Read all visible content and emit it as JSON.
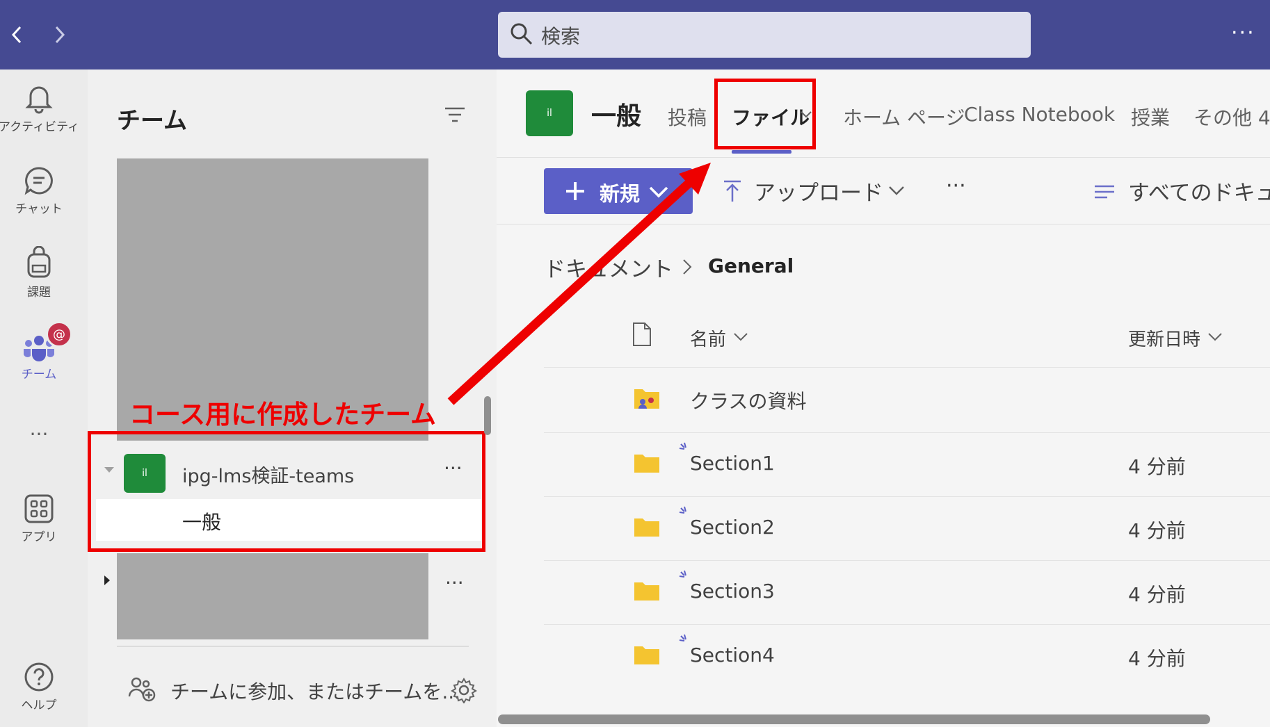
{
  "search": {
    "placeholder": "検索"
  },
  "rail": {
    "items": [
      {
        "label": "アクティビティ",
        "icon": "bell-icon"
      },
      {
        "label": "チャット",
        "icon": "chat-icon"
      },
      {
        "label": "課題",
        "icon": "backpack-icon"
      },
      {
        "label": "チーム",
        "icon": "teams-icon",
        "badge": "@"
      },
      {
        "label": "アプリ",
        "icon": "apps-icon"
      },
      {
        "label": "ヘルプ",
        "icon": "help-icon"
      }
    ]
  },
  "teams_panel": {
    "title": "チーム",
    "team": {
      "name": "ipg-lms検証-teams",
      "avatar": "il",
      "more": "···"
    },
    "channel": {
      "name": "一般"
    },
    "join_text": "チームに参加、またはチームを..."
  },
  "channel_header": {
    "avatar": "il",
    "title": "一般",
    "tabs": [
      {
        "label": "投稿"
      },
      {
        "label": "ファイル"
      },
      {
        "label": "ホーム ページ"
      },
      {
        "label": "Class Notebook"
      },
      {
        "label": "授業"
      },
      {
        "label": "その他 4"
      }
    ]
  },
  "commands": {
    "new_label": "新規",
    "upload_label": "アップロード",
    "more": "···",
    "all_docs": "すべてのドキュ"
  },
  "breadcrumb": {
    "root": "ドキュメント",
    "current": "General"
  },
  "file_table": {
    "columns": {
      "name": "名前",
      "modified": "更新日時"
    },
    "rows": [
      {
        "name": "クラスの資料",
        "modified": "",
        "icon": "shared-folder-icon"
      },
      {
        "name": "Section1",
        "modified": "4 分前",
        "icon": "folder-icon"
      },
      {
        "name": "Section2",
        "modified": "4 分前",
        "icon": "folder-icon"
      },
      {
        "name": "Section3",
        "modified": "4 分前",
        "icon": "folder-icon"
      },
      {
        "name": "Section4",
        "modified": "4 分前",
        "icon": "folder-icon"
      }
    ]
  },
  "annotation": {
    "text": "コース用に作成したチーム",
    "color": "#ee0000"
  },
  "colors": {
    "titlebar": "#454a92",
    "accent": "#5b5fc7",
    "team_avatar": "#1f8b3a",
    "folder": "#f4c430"
  }
}
